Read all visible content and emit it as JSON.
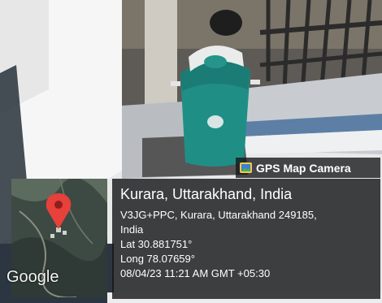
{
  "badge": {
    "label": "GPS Map Camera",
    "icon": "camera-icon"
  },
  "map": {
    "brand": "Google",
    "marker_icon": "map-pin-icon"
  },
  "location": {
    "title": "Kurara, Uttarakhand, India",
    "address_line1": "V3JG+PPC, Kurara, Uttarakhand 249185,",
    "address_line2": "India",
    "lat": "Lat 30.881751°",
    "long": "Long 78.07659°",
    "timestamp": "08/04/23 11:21 AM GMT +05:30"
  },
  "colors": {
    "bin": "#1f8f86",
    "pin": "#e8403a",
    "overlay": "#16181a"
  }
}
